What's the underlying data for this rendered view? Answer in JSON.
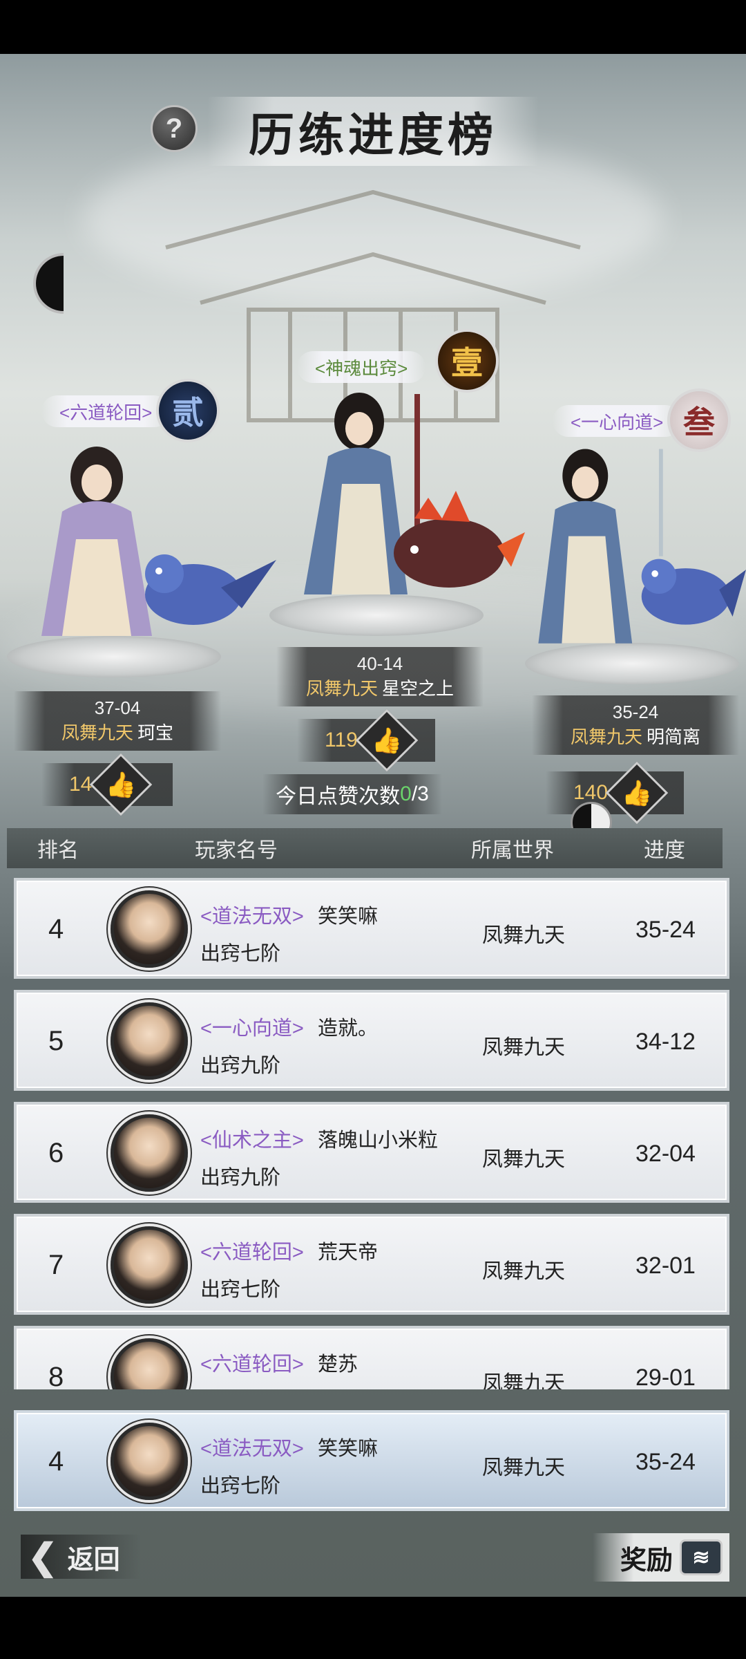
{
  "header": {
    "title": "历练进度榜",
    "help_label": "?"
  },
  "podium": {
    "first": {
      "title": "<神魂出窍>",
      "rank_glyph": "壹",
      "progress": "40-14",
      "world": "凤舞九天",
      "player": "星空之上",
      "likes": "119"
    },
    "second": {
      "title": "<六道轮回>",
      "rank_glyph": "贰",
      "progress": "37-04",
      "world": "凤舞九天",
      "player": "珂宝",
      "likes": "14"
    },
    "third": {
      "title": "<一心向道>",
      "rank_glyph": "叁",
      "progress": "35-24",
      "world": "凤舞九天",
      "player": "明简离",
      "likes": "140"
    }
  },
  "today_likes": {
    "label": "今日点赞次数",
    "used": "0",
    "total": "/3"
  },
  "table": {
    "headers": {
      "rank": "排名",
      "player": "玩家名号",
      "world": "所属世界",
      "progress": "进度"
    },
    "rows": [
      {
        "rank": "4",
        "title": "<道法无双>",
        "name": "笑笑嘛",
        "stage": "出窍七阶",
        "world": "凤舞九天",
        "progress": "35-24"
      },
      {
        "rank": "5",
        "title": "<一心向道>",
        "name": "造就。",
        "stage": "出窍九阶",
        "world": "凤舞九天",
        "progress": "34-12"
      },
      {
        "rank": "6",
        "title": "<仙术之主>",
        "name": "落魄山小米粒",
        "stage": "出窍九阶",
        "world": "凤舞九天",
        "progress": "32-04"
      },
      {
        "rank": "7",
        "title": "<六道轮回>",
        "name": "荒天帝",
        "stage": "出窍七阶",
        "world": "凤舞九天",
        "progress": "32-01"
      },
      {
        "rank": "8",
        "title": "<六道轮回>",
        "name": "楚苏",
        "stage": "",
        "world": "凤舞九天",
        "progress": "29-01"
      }
    ]
  },
  "self_row": {
    "rank": "4",
    "title": "<道法无双>",
    "name": "笑笑嘛",
    "stage": "出窍七阶",
    "world": "凤舞九天",
    "progress": "35-24"
  },
  "footer": {
    "back_label": "返回",
    "reward_label": "奖励"
  }
}
